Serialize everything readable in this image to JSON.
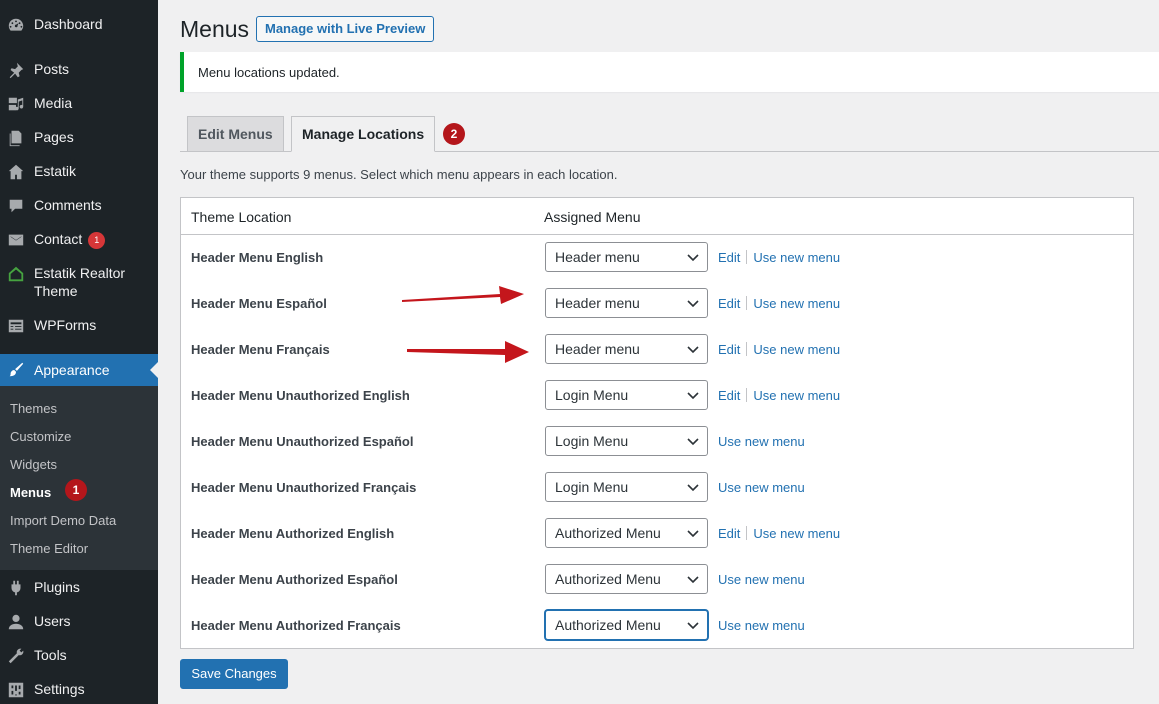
{
  "sidebar": {
    "items": [
      {
        "label": "Dashboard",
        "icon": "dashboard-icon"
      },
      {
        "label": "Posts",
        "icon": "pin-icon"
      },
      {
        "label": "Media",
        "icon": "media-icon"
      },
      {
        "label": "Pages",
        "icon": "pages-icon"
      },
      {
        "label": "Estatik",
        "icon": "house-icon"
      },
      {
        "label": "Comments",
        "icon": "comment-icon"
      },
      {
        "label": "Contact",
        "icon": "mail-icon",
        "badge": "1"
      },
      {
        "label": "Estatik Realtor Theme",
        "icon": "theme-house-icon"
      },
      {
        "label": "WPForms",
        "icon": "forms-icon"
      },
      {
        "label": "Appearance",
        "icon": "brush-icon"
      },
      {
        "label": "Plugins",
        "icon": "plugin-icon"
      },
      {
        "label": "Users",
        "icon": "user-icon"
      },
      {
        "label": "Tools",
        "icon": "wrench-icon"
      },
      {
        "label": "Settings",
        "icon": "settings-icon"
      }
    ],
    "submenu": [
      "Themes",
      "Customize",
      "Widgets",
      "Menus",
      "Import Demo Data",
      "Theme Editor"
    ],
    "menus_step": "1"
  },
  "header": {
    "title": "Menus",
    "live_preview": "Manage with Live Preview"
  },
  "notice": "Menu locations updated.",
  "tabs": {
    "edit": "Edit Menus",
    "manage": "Manage Locations",
    "step": "2"
  },
  "intro": "Your theme supports 9 menus. Select which menu appears in each location.",
  "table": {
    "col_location": "Theme Location",
    "col_menu": "Assigned Menu",
    "edit_label": "Edit",
    "use_new_label": "Use new menu",
    "rows": [
      {
        "location": "Header Menu English",
        "menu": "Header menu"
      },
      {
        "location": "Header Menu Español",
        "menu": "Header menu"
      },
      {
        "location": "Header Menu Français",
        "menu": "Header menu"
      },
      {
        "location": "Header Menu Unauthorized English",
        "menu": "Login Menu"
      },
      {
        "location": "Header Menu Unauthorized Español",
        "menu": "Login Menu"
      },
      {
        "location": "Header Menu Unauthorized Français",
        "menu": "Login Menu"
      },
      {
        "location": "Header Menu Authorized English",
        "menu": "Authorized Menu"
      },
      {
        "location": "Header Menu Authorized Español",
        "menu": "Authorized Menu"
      },
      {
        "location": "Header Menu Authorized Français",
        "menu": "Authorized Menu"
      }
    ]
  },
  "save": "Save Changes",
  "colors": {
    "sidebar": "#1d2327",
    "accent": "#2271b1",
    "notice_green": "#00a32a",
    "annotation_red": "#b4161b"
  }
}
